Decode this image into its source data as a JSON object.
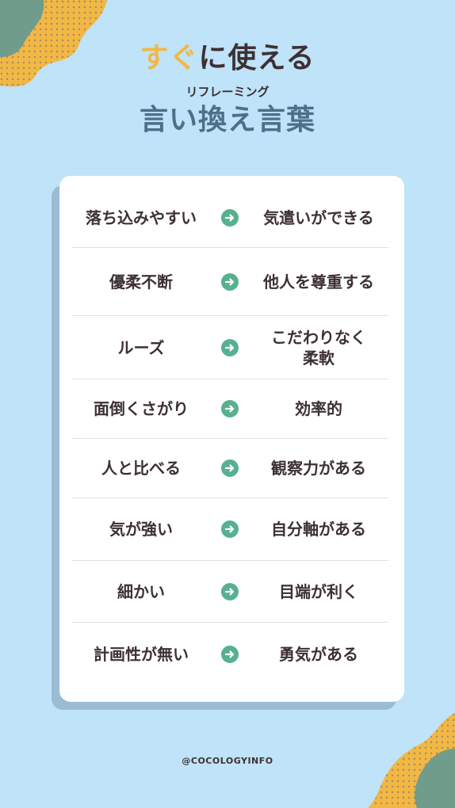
{
  "colors": {
    "background": "#bfe3f8",
    "accent_yellow": "#f3b744",
    "title_dark": "#3d3033",
    "title_blue": "#4e6f8a",
    "arrow_green": "#57b08f",
    "blob_green": "#6f9c8b"
  },
  "title": {
    "line1_accent": "すぐ",
    "line1_rest": "に使える",
    "subtitle": "リフレーミング",
    "line2": "言い換え言葉"
  },
  "pairs": [
    {
      "from": "落ち込みやすい",
      "to": "気遣いができる"
    },
    {
      "from": "優柔不断",
      "to": "他人を尊重する"
    },
    {
      "from": "ルーズ",
      "to": "こだわりなく\n柔軟"
    },
    {
      "from": "面倒くさがり",
      "to": "効率的"
    },
    {
      "from": "人と比べる",
      "to": "観察力がある"
    },
    {
      "from": "気が強い",
      "to": "自分軸がある"
    },
    {
      "from": "細かい",
      "to": "目端が利く"
    },
    {
      "from": "計画性が無い",
      "to": "勇気がある"
    }
  ],
  "arrow_icon": "arrow-right-circle-icon",
  "footer": "@COCOLOGYINFO"
}
